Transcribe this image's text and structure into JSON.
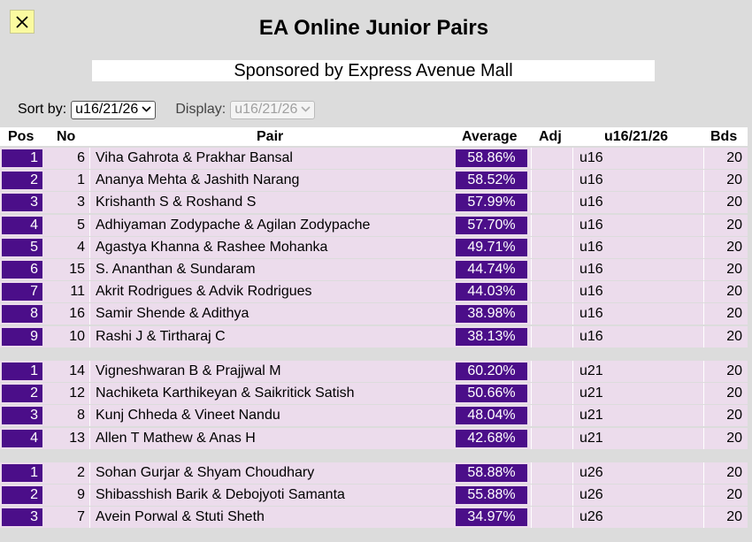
{
  "page": {
    "title": "EA Online Junior Pairs",
    "sponsor": "Sponsored by Express Avenue Mall"
  },
  "controls": {
    "sort_label": "Sort by:",
    "sort_value": "u16/21/26",
    "display_label": "Display:",
    "display_value": "u16/21/26"
  },
  "columns": {
    "pos": "Pos",
    "no": "No",
    "pair": "Pair",
    "average": "Average",
    "adj": "Adj",
    "group": "u16/21/26",
    "bds": "Bds"
  },
  "colors": {
    "accent": "#4b0e89",
    "row_bg": "#ecdcec",
    "close_bg": "#fafaa0"
  },
  "groups": [
    {
      "name": "u16",
      "rows": [
        {
          "pos": "1",
          "no": "6",
          "pair": "Viha Gahrota & Prakhar Bansal",
          "average": "58.86%",
          "adj": "",
          "group": "u16",
          "bds": "20"
        },
        {
          "pos": "2",
          "no": "1",
          "pair": "Ananya Mehta & Jashith Narang",
          "average": "58.52%",
          "adj": "",
          "group": "u16",
          "bds": "20"
        },
        {
          "pos": "3",
          "no": "3",
          "pair": "Krishanth S & Roshand S",
          "average": "57.99%",
          "adj": "",
          "group": "u16",
          "bds": "20"
        },
        {
          "pos": "4",
          "no": "5",
          "pair": "Adhiyaman Zodypache & Agilan Zodypache",
          "average": "57.70%",
          "adj": "",
          "group": "u16",
          "bds": "20"
        },
        {
          "pos": "5",
          "no": "4",
          "pair": "Agastya Khanna & Rashee Mohanka",
          "average": "49.71%",
          "adj": "",
          "group": "u16",
          "bds": "20"
        },
        {
          "pos": "6",
          "no": "15",
          "pair": "S. Ananthan & Sundaram",
          "average": "44.74%",
          "adj": "",
          "group": "u16",
          "bds": "20"
        },
        {
          "pos": "7",
          "no": "11",
          "pair": "Akrit Rodrigues & Advik Rodrigues",
          "average": "44.03%",
          "adj": "",
          "group": "u16",
          "bds": "20"
        },
        {
          "pos": "8",
          "no": "16",
          "pair": "Samir Shende & Adithya",
          "average": "38.98%",
          "adj": "",
          "group": "u16",
          "bds": "20"
        },
        {
          "pos": "9",
          "no": "10",
          "pair": "Rashi J & Tirtharaj C",
          "average": "38.13%",
          "adj": "",
          "group": "u16",
          "bds": "20"
        }
      ]
    },
    {
      "name": "u21",
      "rows": [
        {
          "pos": "1",
          "no": "14",
          "pair": "Vigneshwaran B & Prajjwal M",
          "average": "60.20%",
          "adj": "",
          "group": "u21",
          "bds": "20"
        },
        {
          "pos": "2",
          "no": "12",
          "pair": "Nachiketa Karthikeyan & Saikritick Satish",
          "average": "50.66%",
          "adj": "",
          "group": "u21",
          "bds": "20"
        },
        {
          "pos": "3",
          "no": "8",
          "pair": "Kunj Chheda & Vineet Nandu",
          "average": "48.04%",
          "adj": "",
          "group": "u21",
          "bds": "20"
        },
        {
          "pos": "4",
          "no": "13",
          "pair": "Allen T Mathew & Anas H",
          "average": "42.68%",
          "adj": "",
          "group": "u21",
          "bds": "20"
        }
      ]
    },
    {
      "name": "u26",
      "rows": [
        {
          "pos": "1",
          "no": "2",
          "pair": "Sohan Gurjar & Shyam Choudhary",
          "average": "58.88%",
          "adj": "",
          "group": "u26",
          "bds": "20"
        },
        {
          "pos": "2",
          "no": "9",
          "pair": "Shibasshish Barik & Debojyoti Samanta",
          "average": "55.88%",
          "adj": "",
          "group": "u26",
          "bds": "20"
        },
        {
          "pos": "3",
          "no": "7",
          "pair": "Avein Porwal & Stuti Sheth",
          "average": "34.97%",
          "adj": "",
          "group": "u26",
          "bds": "20"
        }
      ]
    }
  ]
}
